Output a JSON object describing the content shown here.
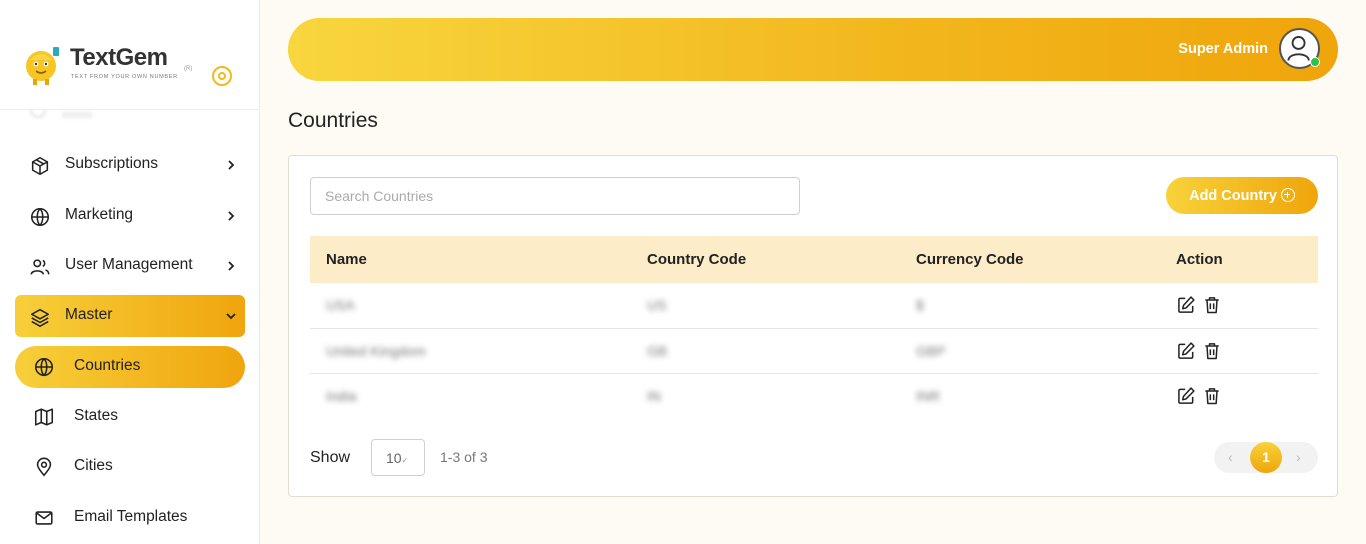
{
  "brand": {
    "name": "TextGem",
    "tagline": "TEXT FROM YOUR OWN NUMBER",
    "mark": "(R)"
  },
  "sidebar": {
    "items": [
      {
        "label": "Subscriptions",
        "icon": "box-icon",
        "has_chevron": true
      },
      {
        "label": "Marketing",
        "icon": "globe-icon",
        "has_chevron": true
      },
      {
        "label": "User Management",
        "icon": "users-icon",
        "has_chevron": true
      },
      {
        "label": "Master",
        "icon": "layers-icon",
        "expanded": true
      }
    ],
    "sub_items": [
      {
        "label": "Countries",
        "icon": "globe-icon",
        "active": true
      },
      {
        "label": "States",
        "icon": "map-icon"
      },
      {
        "label": "Cities",
        "icon": "map-pin-icon"
      },
      {
        "label": "Email Templates",
        "icon": "mail-icon"
      }
    ]
  },
  "header": {
    "user_name": "Super Admin",
    "status_color": "#29c24c"
  },
  "page": {
    "title": "Countries"
  },
  "toolbar": {
    "search_placeholder": "Search Countries",
    "add_label": "Add Country"
  },
  "table": {
    "columns": [
      "Name",
      "Country Code",
      "Currency Code",
      "Action"
    ],
    "rows": [
      {
        "name": "USA",
        "country_code": "US",
        "currency_code": "$"
      },
      {
        "name": "United Kingdom",
        "country_code": "GB",
        "currency_code": "GBP"
      },
      {
        "name": "India",
        "country_code": "IN",
        "currency_code": "INR"
      }
    ]
  },
  "pagination": {
    "show_label": "Show",
    "page_size": "10",
    "range": "1-3 of 3",
    "current_page": "1",
    "prev": "‹",
    "next": "›"
  },
  "colors": {
    "accent_start": "#f8d63e",
    "accent_end": "#efa50b",
    "header_row": "#fcecc8"
  }
}
